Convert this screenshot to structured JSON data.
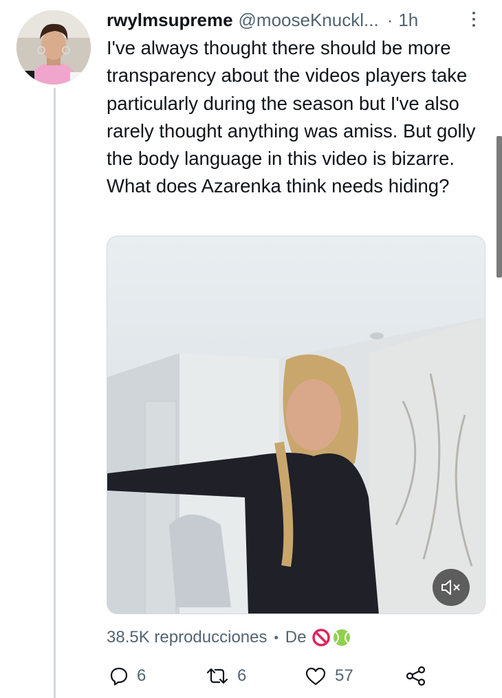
{
  "tweet": {
    "display_name": "rwylmsupreme",
    "handle": "@mooseKnuckl...",
    "separator": "·",
    "time": "1h",
    "text": "I've always thought there should be more transparency about the videos players take particularly during the season but I've also rarely thought anything was amiss. But golly the body language in this video is bizarre. What does Azarenka think needs hiding?",
    "views": "38.5K reproducciones",
    "views_separator": "•",
    "from_label": "De"
  },
  "actions": {
    "reply_count": "6",
    "retweet_count": "6",
    "like_count": "57"
  },
  "icons": {
    "more": "more-vertical-icon",
    "mute": "volume-muted-icon",
    "reply": "reply-icon",
    "retweet": "retweet-icon",
    "like": "heart-icon",
    "share": "share-icon",
    "emoji_1": "no-entry-sign-emoji",
    "emoji_2": "tennis-ball-emoji"
  },
  "colors": {
    "text": "#0f1419",
    "secondary": "#536471",
    "thread_line": "#cfd9de"
  }
}
